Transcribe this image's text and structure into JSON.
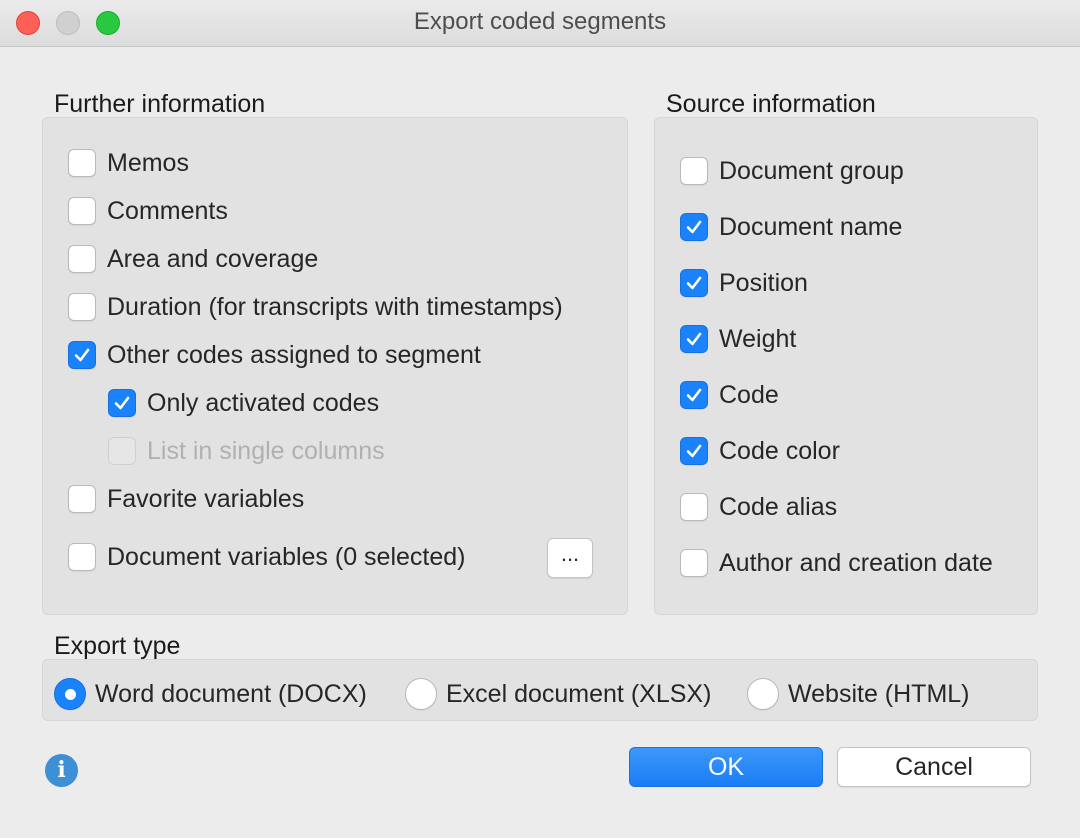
{
  "window": {
    "title": "Export coded segments"
  },
  "further_information": {
    "label": "Further information",
    "options": [
      {
        "label": "Memos",
        "checked": false,
        "disabled": false
      },
      {
        "label": "Comments",
        "checked": false,
        "disabled": false
      },
      {
        "label": "Area and coverage",
        "checked": false,
        "disabled": false
      },
      {
        "label": "Duration (for transcripts with timestamps)",
        "checked": false,
        "disabled": false
      },
      {
        "label": "Other codes assigned to segment",
        "checked": true,
        "disabled": false
      },
      {
        "label": "Only activated codes",
        "checked": true,
        "disabled": false
      },
      {
        "label": "List in single columns",
        "checked": false,
        "disabled": true
      },
      {
        "label": "Favorite variables",
        "checked": false,
        "disabled": false
      },
      {
        "label": "Document variables (0 selected)",
        "checked": false,
        "disabled": false
      }
    ],
    "more_button_label": "..."
  },
  "source_information": {
    "label": "Source information",
    "options": [
      {
        "label": "Document group",
        "checked": false
      },
      {
        "label": "Document name",
        "checked": true
      },
      {
        "label": "Position",
        "checked": true
      },
      {
        "label": "Weight",
        "checked": true
      },
      {
        "label": "Code",
        "checked": true
      },
      {
        "label": "Code color",
        "checked": true
      },
      {
        "label": "Code alias",
        "checked": false
      },
      {
        "label": "Author and creation date",
        "checked": false
      }
    ]
  },
  "export_type": {
    "label": "Export type",
    "options": [
      {
        "label": "Word document (DOCX)",
        "selected": true
      },
      {
        "label": "Excel document (XLSX)",
        "selected": false
      },
      {
        "label": "Website (HTML)",
        "selected": false
      }
    ]
  },
  "buttons": {
    "ok": "OK",
    "cancel": "Cancel"
  },
  "icons": {
    "info": "info-icon"
  },
  "colors": {
    "accent": "#1a82fb",
    "ok_button": "#2488f8"
  }
}
